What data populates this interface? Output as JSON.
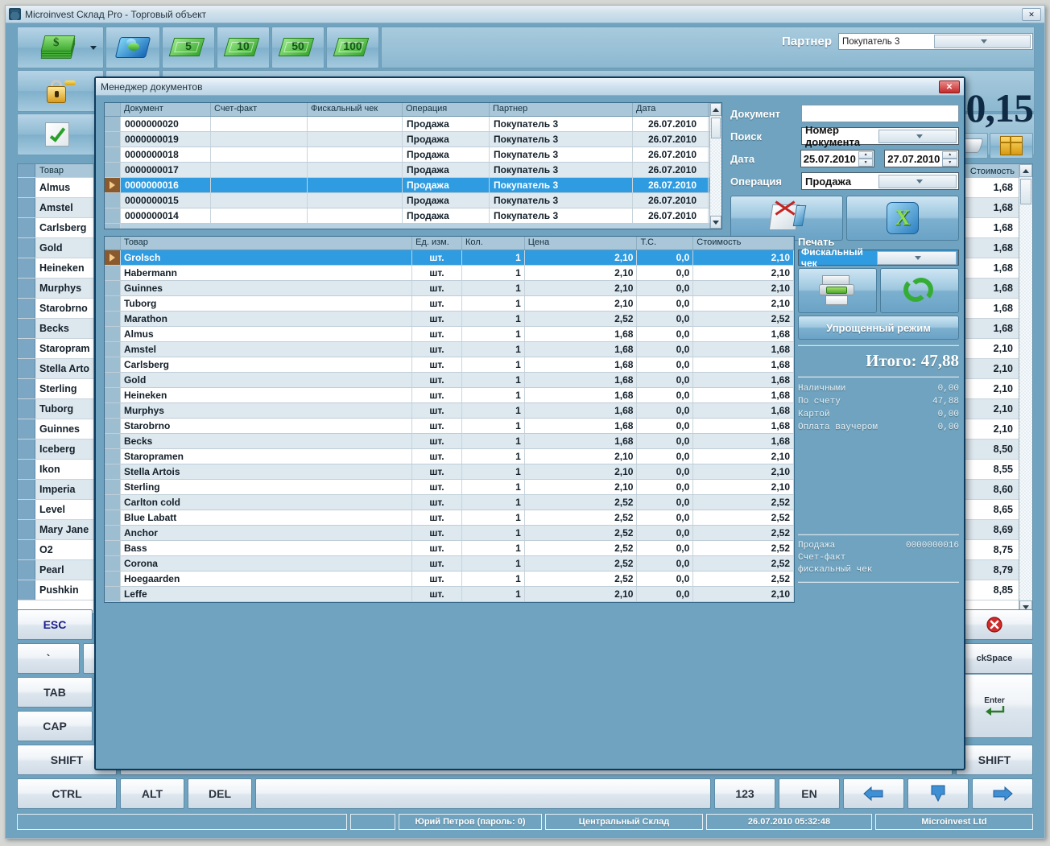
{
  "window": {
    "title": "Microinvest Склад Pro - Торговый объект",
    "close_label": "✕",
    "icon": "app-icon"
  },
  "toolbar": {
    "money_label": "$",
    "denominations": [
      "5",
      "10",
      "50",
      "100"
    ],
    "card_icon": "card-icon",
    "lock_icon": "lock-icon",
    "document_icon": "document-icon",
    "check_icon": "check-document-icon",
    "red_doc_icon": "red-document-icon",
    "scanner_icon": "scanner-icon",
    "box_icon": "box-icon"
  },
  "partner": {
    "label": "Партнер",
    "value": "Покупатель 3"
  },
  "total_display": "0,15",
  "left_grid": {
    "header": "Товар",
    "items": [
      "Almus",
      "Amstel",
      "Carlsberg",
      "Gold",
      "Heineken",
      "Murphys",
      "Starobrno",
      "Becks",
      "Staropram",
      "Stella Arto",
      "Sterling",
      "Tuborg",
      "Guinnes",
      "Iceberg",
      "Ikon",
      "Imperia",
      "Level",
      "Mary Jane",
      "O2",
      "Pearl",
      "Pushkin"
    ]
  },
  "right_grid": {
    "header": "Стоимость",
    "values": [
      "1,68",
      "1,68",
      "1,68",
      "1,68",
      "1,68",
      "1,68",
      "1,68",
      "1,68",
      "2,10",
      "2,10",
      "2,10",
      "2,10",
      "2,10",
      "8,50",
      "8,55",
      "8,60",
      "8,65",
      "8,69",
      "8,75",
      "8,79",
      "8,85"
    ]
  },
  "dialog": {
    "title": "Менеджер документов",
    "close_label": "✕",
    "doc_table": {
      "columns": [
        "",
        "Документ",
        "Счет-факт",
        "Фискальный чек",
        "Операция",
        "Партнер",
        "Дата"
      ],
      "rows": [
        {
          "doc": "0000000020",
          "invoice": "",
          "fiscal": "",
          "operation": "Продажа",
          "partner": "Покупатель 3",
          "date": "26.07.2010",
          "selected": false
        },
        {
          "doc": "0000000019",
          "invoice": "",
          "fiscal": "",
          "operation": "Продажа",
          "partner": "Покупатель 3",
          "date": "26.07.2010",
          "selected": false
        },
        {
          "doc": "0000000018",
          "invoice": "",
          "fiscal": "",
          "operation": "Продажа",
          "partner": "Покупатель 3",
          "date": "26.07.2010",
          "selected": false
        },
        {
          "doc": "0000000017",
          "invoice": "",
          "fiscal": "",
          "operation": "Продажа",
          "partner": "Покупатель 3",
          "date": "26.07.2010",
          "selected": false
        },
        {
          "doc": "0000000016",
          "invoice": "",
          "fiscal": "",
          "operation": "Продажа",
          "partner": "Покупатель 3",
          "date": "26.07.2010",
          "selected": true
        },
        {
          "doc": "0000000015",
          "invoice": "",
          "fiscal": "",
          "operation": "Продажа",
          "partner": "Покупатель 3",
          "date": "26.07.2010",
          "selected": false
        },
        {
          "doc": "0000000014",
          "invoice": "",
          "fiscal": "",
          "operation": "Продажа",
          "partner": "Покупатель 3",
          "date": "26.07.2010",
          "selected": false
        }
      ]
    },
    "search": {
      "document_label": "Документ",
      "document_value": "",
      "search_label": "Поиск",
      "search_value": "Номер документа",
      "date_label": "Дата",
      "date_from": "25.07.2010",
      "date_to": "27.07.2010",
      "operation_label": "Операция",
      "operation_value": "Продажа",
      "clear_icon": "clear-document-icon",
      "excel_icon": "excel-export-icon"
    },
    "items_table": {
      "columns": [
        "",
        "Товар",
        "Ед. изм.",
        "Кол.",
        "Цена",
        "Т.С.",
        "Стоимость"
      ],
      "rows": [
        {
          "name": "Grolsch",
          "unit": "шт.",
          "qty": "1",
          "price": "2,10",
          "ts": "0,0",
          "sum": "2,10",
          "selected": true
        },
        {
          "name": "Habermann",
          "unit": "шт.",
          "qty": "1",
          "price": "2,10",
          "ts": "0,0",
          "sum": "2,10",
          "selected": false
        },
        {
          "name": "Guinnes",
          "unit": "шт.",
          "qty": "1",
          "price": "2,10",
          "ts": "0,0",
          "sum": "2,10",
          "selected": false
        },
        {
          "name": "Tuborg",
          "unit": "шт.",
          "qty": "1",
          "price": "2,10",
          "ts": "0,0",
          "sum": "2,10",
          "selected": false
        },
        {
          "name": "Marathon",
          "unit": "шт.",
          "qty": "1",
          "price": "2,52",
          "ts": "0,0",
          "sum": "2,52",
          "selected": false
        },
        {
          "name": "Almus",
          "unit": "шт.",
          "qty": "1",
          "price": "1,68",
          "ts": "0,0",
          "sum": "1,68",
          "selected": false
        },
        {
          "name": "Amstel",
          "unit": "шт.",
          "qty": "1",
          "price": "1,68",
          "ts": "0,0",
          "sum": "1,68",
          "selected": false
        },
        {
          "name": "Carlsberg",
          "unit": "шт.",
          "qty": "1",
          "price": "1,68",
          "ts": "0,0",
          "sum": "1,68",
          "selected": false
        },
        {
          "name": "Gold",
          "unit": "шт.",
          "qty": "1",
          "price": "1,68",
          "ts": "0,0",
          "sum": "1,68",
          "selected": false
        },
        {
          "name": "Heineken",
          "unit": "шт.",
          "qty": "1",
          "price": "1,68",
          "ts": "0,0",
          "sum": "1,68",
          "selected": false
        },
        {
          "name": "Murphys",
          "unit": "шт.",
          "qty": "1",
          "price": "1,68",
          "ts": "0,0",
          "sum": "1,68",
          "selected": false
        },
        {
          "name": "Starobrno",
          "unit": "шт.",
          "qty": "1",
          "price": "1,68",
          "ts": "0,0",
          "sum": "1,68",
          "selected": false
        },
        {
          "name": "Becks",
          "unit": "шт.",
          "qty": "1",
          "price": "1,68",
          "ts": "0,0",
          "sum": "1,68",
          "selected": false
        },
        {
          "name": "Staropramen",
          "unit": "шт.",
          "qty": "1",
          "price": "2,10",
          "ts": "0,0",
          "sum": "2,10",
          "selected": false
        },
        {
          "name": "Stella Artois",
          "unit": "шт.",
          "qty": "1",
          "price": "2,10",
          "ts": "0,0",
          "sum": "2,10",
          "selected": false
        },
        {
          "name": "Sterling",
          "unit": "шт.",
          "qty": "1",
          "price": "2,10",
          "ts": "0,0",
          "sum": "2,10",
          "selected": false
        },
        {
          "name": "Carlton cold",
          "unit": "шт.",
          "qty": "1",
          "price": "2,52",
          "ts": "0,0",
          "sum": "2,52",
          "selected": false
        },
        {
          "name": "Blue Labatt",
          "unit": "шт.",
          "qty": "1",
          "price": "2,52",
          "ts": "0,0",
          "sum": "2,52",
          "selected": false
        },
        {
          "name": "Anchor",
          "unit": "шт.",
          "qty": "1",
          "price": "2,52",
          "ts": "0,0",
          "sum": "2,52",
          "selected": false
        },
        {
          "name": "Bass",
          "unit": "шт.",
          "qty": "1",
          "price": "2,52",
          "ts": "0,0",
          "sum": "2,52",
          "selected": false
        },
        {
          "name": "Corona",
          "unit": "шт.",
          "qty": "1",
          "price": "2,52",
          "ts": "0,0",
          "sum": "2,52",
          "selected": false
        },
        {
          "name": "Hoegaarden",
          "unit": "шт.",
          "qty": "1",
          "price": "2,52",
          "ts": "0,0",
          "sum": "2,52",
          "selected": false
        },
        {
          "name": "Leffe",
          "unit": "шт.",
          "qty": "1",
          "price": "2,10",
          "ts": "0,0",
          "sum": "2,10",
          "selected": false
        }
      ]
    },
    "print": {
      "title": "Печать",
      "selected": "Фискальный чек",
      "print_icon": "printer-icon",
      "refresh_icon": "refresh-icon",
      "simple_mode": "Упрощенный режим",
      "total_label": "Итого:",
      "total_value": "47,88",
      "payments": [
        {
          "label": "Наличными",
          "value": "0,00"
        },
        {
          "label": "По счету",
          "value": "47,88"
        },
        {
          "label": "Картой",
          "value": "0,00"
        },
        {
          "label": "Оплата ваучером",
          "value": "0,00"
        }
      ],
      "footer": [
        {
          "label": "Продажа",
          "value": "0000000016"
        },
        {
          "label": "Счет-факт",
          "value": ""
        },
        {
          "label": "фискальный чек",
          "value": ""
        }
      ]
    }
  },
  "keyboard": {
    "row_esc": [
      "ESC"
    ],
    "row_tilde": [
      "`"
    ],
    "row_tab": [
      "TAB"
    ],
    "row_caps": [
      "CAP"
    ],
    "row_shift": [
      "SHIFT"
    ],
    "row_bottom": [
      "CTRL",
      "ALT",
      "DEL"
    ],
    "space": "",
    "num_toggle": "123",
    "lang_toggle": "EN",
    "arrow_left": "arrow-left-icon",
    "arrow_down": "arrow-down-icon",
    "arrow_right": "arrow-right-icon",
    "close_red": "close-red-icon",
    "backspace": "ckSpace",
    "enter": "Enter",
    "shift_right": "SHIFT"
  },
  "status_bar": {
    "user": "Юрий Петров (пароль: 0)",
    "warehouse": "Центральный Склад",
    "datetime": "26.07.2010 05:32:48",
    "company": "Microinvest Ltd"
  }
}
